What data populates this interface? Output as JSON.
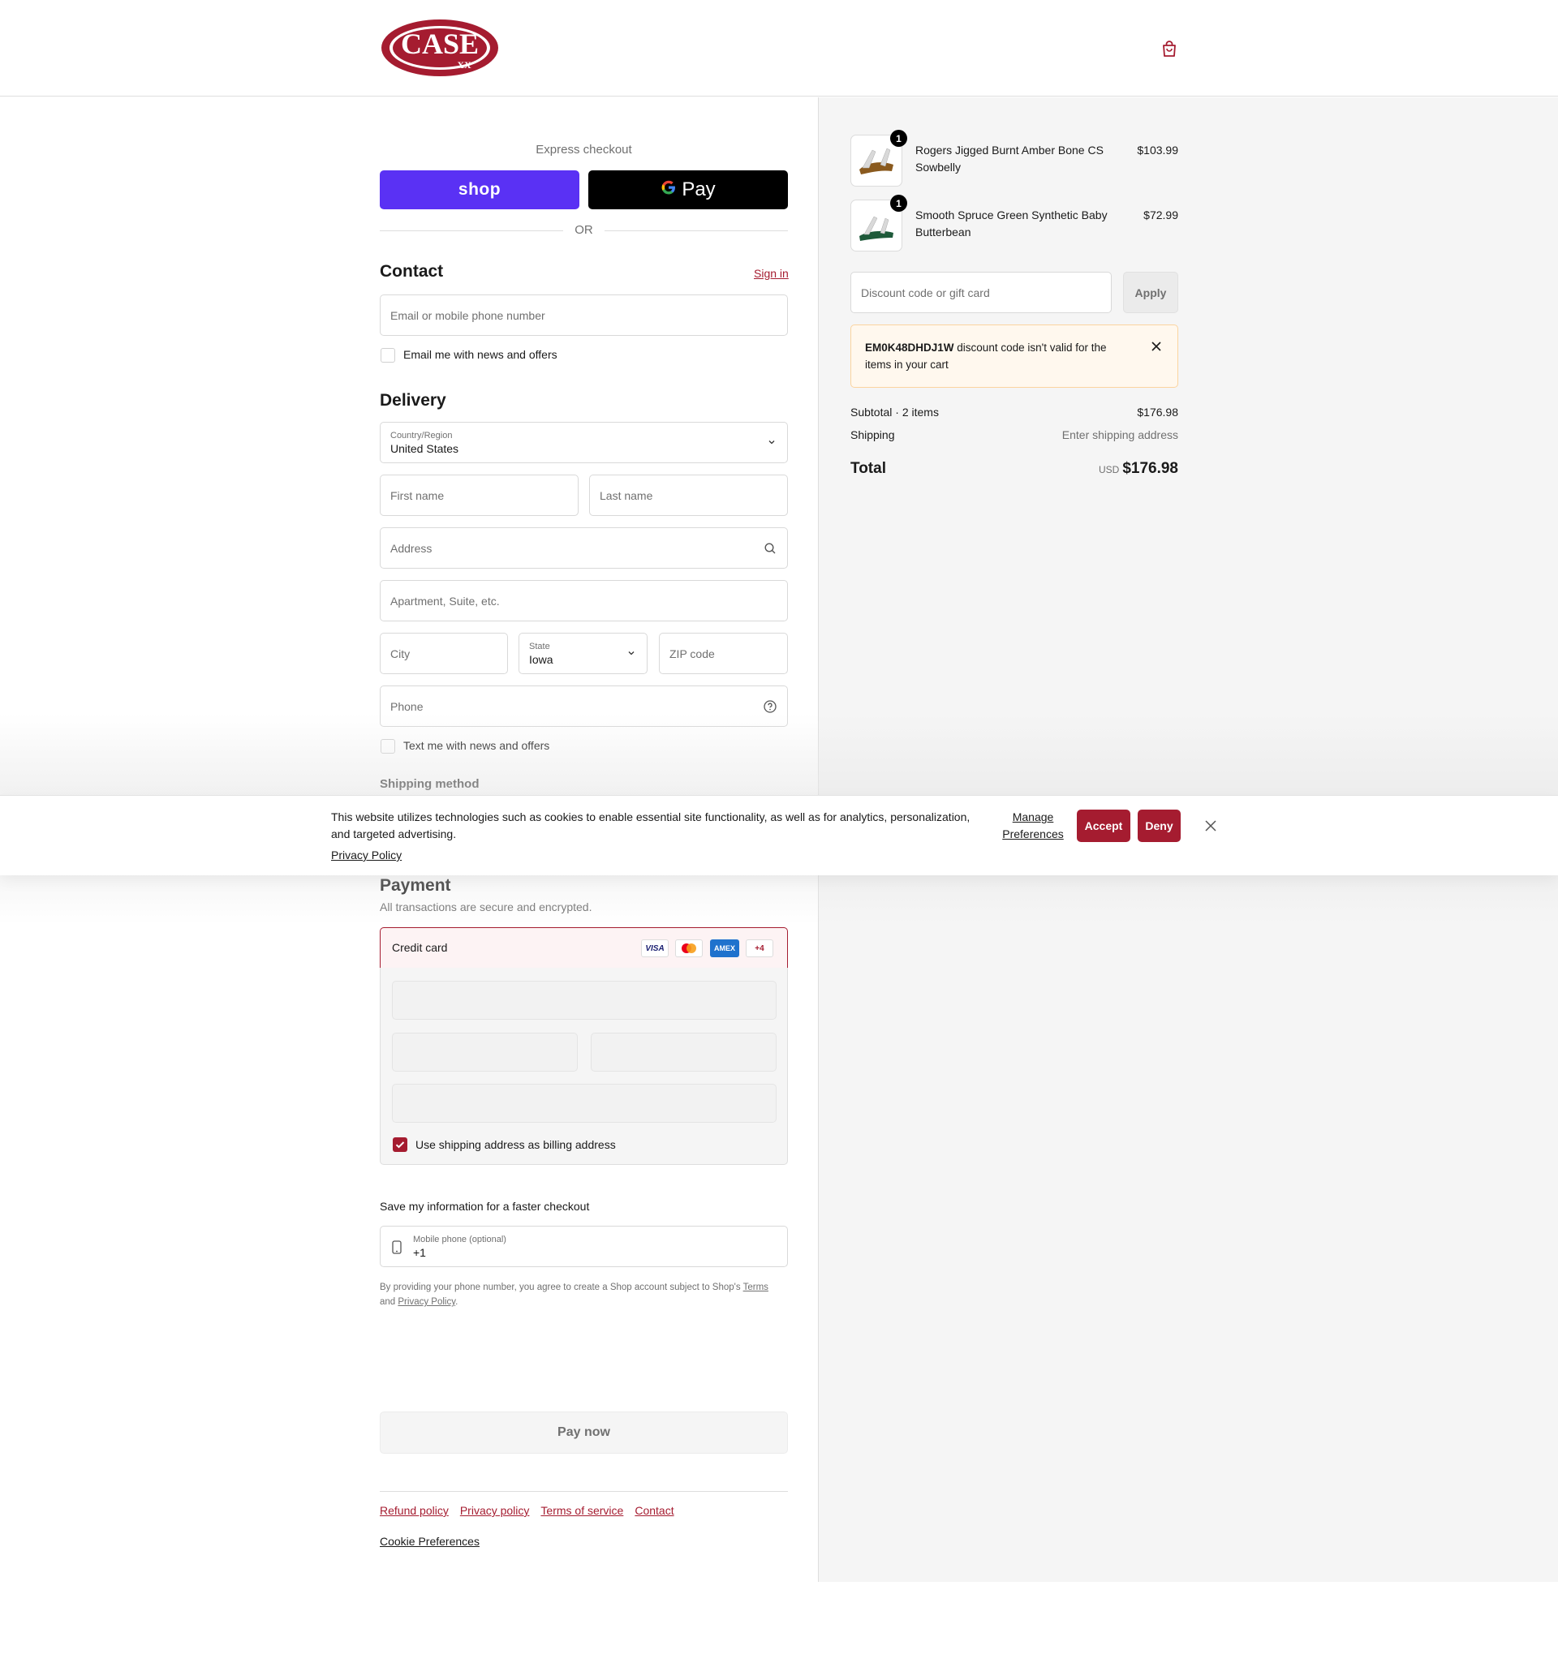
{
  "header": {
    "logo_text": "CASE",
    "logo_sub": "XX"
  },
  "express": {
    "label": "Express checkout",
    "shop_label": "shop",
    "gpay_label": "Pay",
    "or_label": "OR"
  },
  "contact": {
    "title": "Contact",
    "sign_in": "Sign in",
    "email_placeholder": "Email or mobile phone number",
    "newsletter_label": "Email me with news and offers"
  },
  "delivery": {
    "title": "Delivery",
    "country_label": "Country/Region",
    "country_value": "United States",
    "first_name": "First name",
    "last_name": "Last name",
    "address": "Address",
    "apartment": "Apartment, Suite, etc.",
    "city": "City",
    "state_label": "State",
    "state_value": "Iowa",
    "zip": "ZIP code",
    "phone": "Phone",
    "sms_label": "Text me with news and offers"
  },
  "shipping_method": {
    "title": "Shipping method"
  },
  "cookie": {
    "text": "This website utilizes technologies such as cookies to enable essential site functionality, as well as for analytics, personalization, and targeted advertising.",
    "privacy": "Privacy Policy",
    "manage_1": "Manage",
    "manage_2": "Preferences",
    "accept": "Accept",
    "deny": "Deny"
  },
  "payment": {
    "title": "Payment",
    "subtitle": "All transactions are secure and encrypted.",
    "method": "Credit card",
    "brands": [
      "VISA",
      "",
      "AMEX",
      "+4"
    ],
    "billing_label": "Use shipping address as billing address"
  },
  "save_info": {
    "title": "Save my information for a faster checkout",
    "phone_label": "Mobile phone (optional)",
    "phone_value": "+1",
    "legal_1": "By providing your phone number, you agree to create a Shop account subject to Shop's",
    "legal_terms": "Terms",
    "legal_and": "and",
    "legal_privacy": "Privacy Policy",
    "legal_end": "."
  },
  "pay_now": "Pay now",
  "footer": {
    "links": [
      "Refund policy",
      "Privacy policy",
      "Terms of service",
      "Contact"
    ],
    "cookie_prefs": "Cookie Preferences"
  },
  "summary": {
    "items": [
      {
        "qty": "1",
        "name": "Rogers Jigged Burnt Amber Bone CS Sowbelly",
        "price": "$103.99"
      },
      {
        "qty": "1",
        "name": "Smooth Spruce Green Synthetic Baby Butterbean",
        "price": "$72.99"
      }
    ],
    "discount_placeholder": "Discount code or gift card",
    "apply": "Apply",
    "error_code": "EM0K48DHDJ1W",
    "error_text": "discount code isn't valid for the items in your cart",
    "subtotal_label": "Subtotal · 2 items",
    "subtotal_value": "$176.98",
    "shipping_label": "Shipping",
    "shipping_value": "Enter shipping address",
    "total_label": "Total",
    "currency": "USD",
    "total_value": "$176.98"
  },
  "colors": {
    "accent": "#a51c30",
    "shop_pay": "#5a31f4",
    "summary_bg": "#f5f5f5"
  }
}
